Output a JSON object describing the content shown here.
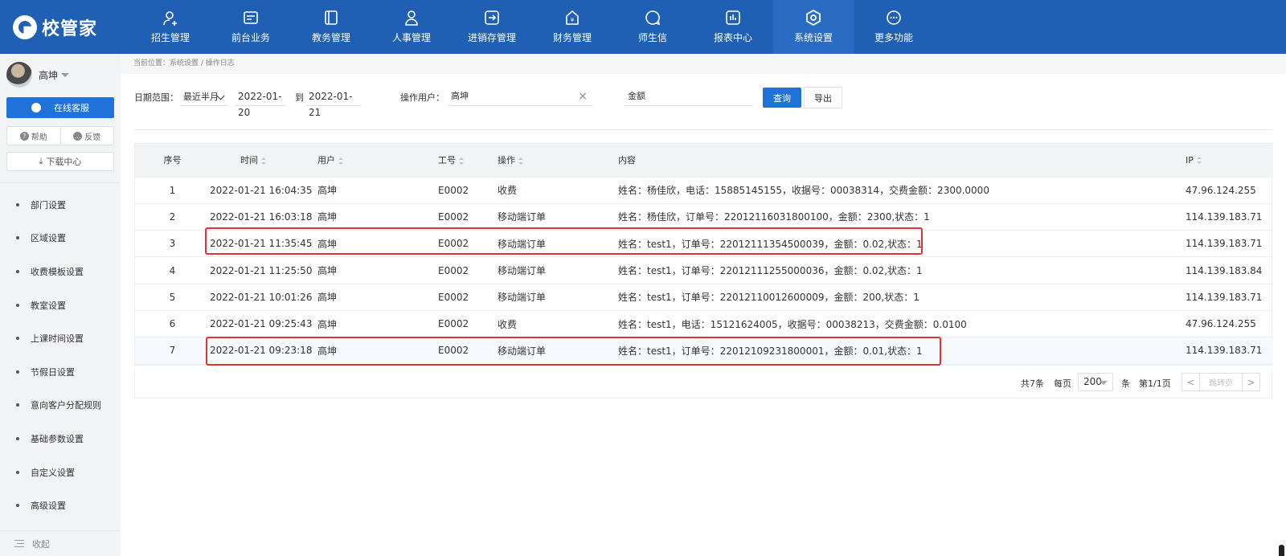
{
  "app": {
    "logo_text": "校管家"
  },
  "nav": [
    {
      "label": "招生管理",
      "icon": "person-add-icon"
    },
    {
      "label": "前台业务",
      "icon": "desk-icon"
    },
    {
      "label": "教务管理",
      "icon": "book-icon"
    },
    {
      "label": "人事管理",
      "icon": "person-icon"
    },
    {
      "label": "进销存管理",
      "icon": "arrow-box-icon"
    },
    {
      "label": "财务管理",
      "icon": "yen-house-icon"
    },
    {
      "label": "师生信",
      "icon": "chat-icon"
    },
    {
      "label": "报表中心",
      "icon": "report-icon"
    },
    {
      "label": "系统设置",
      "icon": "settings-icon",
      "active": true
    },
    {
      "label": "更多功能",
      "icon": "more-icon"
    }
  ],
  "sidebar": {
    "user_name": "高坤",
    "online_service": "在线客服",
    "help": "帮助",
    "feedback": "反馈",
    "download_center": "下载中心",
    "menu": [
      "部门设置",
      "区域设置",
      "收费模板设置",
      "教室设置",
      "上课时间设置",
      "节假日设置",
      "意向客户分配规则",
      "基础参数设置",
      "自定义设置",
      "高级设置"
    ],
    "collapse": "收起"
  },
  "breadcrumb": "当前位置：系统设置 / 操作日志",
  "filters": {
    "date_range_label": "日期范围：",
    "date_range_value": "最近半月",
    "date_from": "2022-01-20",
    "to_label": "到",
    "date_to": "2022-01-21",
    "operator_label": "操作用户：",
    "operator_value": "高坤",
    "clear": "×",
    "keyword_value": "金额",
    "query_btn": "查询",
    "export_btn": "导出"
  },
  "table": {
    "headers": {
      "idx": "序号",
      "time": "时间",
      "user": "用户",
      "job": "工号",
      "op": "操作",
      "content": "内容",
      "ip": "IP"
    },
    "rows": [
      {
        "idx": "1",
        "time": "2022-01-21 16:04:35",
        "user": "高坤",
        "job": "E0002",
        "op": "收费",
        "content": "姓名：杨佳欣，电话：15885145155，收据号：00038314，交费金额：2300.0000",
        "ip": "47.96.124.255"
      },
      {
        "idx": "2",
        "time": "2022-01-21 16:03:18",
        "user": "高坤",
        "job": "E0002",
        "op": "移动端订单",
        "content": "姓名：杨佳欣，订单号：22012116031800100，金额：2300,状态：1",
        "ip": "114.139.183.71"
      },
      {
        "idx": "3",
        "time": "2022-01-21 11:35:45",
        "user": "高坤",
        "job": "E0002",
        "op": "移动端订单",
        "content": "姓名：test1，订单号：22012111354500039，金额：0.02,状态：1",
        "ip": "114.139.183.71"
      },
      {
        "idx": "4",
        "time": "2022-01-21 11:25:50",
        "user": "高坤",
        "job": "E0002",
        "op": "移动端订单",
        "content": "姓名：test1，订单号：22012111255000036，金额：0.02,状态：1",
        "ip": "114.139.183.84"
      },
      {
        "idx": "5",
        "time": "2022-01-21 10:01:26",
        "user": "高坤",
        "job": "E0002",
        "op": "移动端订单",
        "content": "姓名：test1，订单号：22012110012600009，金额：200,状态：1",
        "ip": "114.139.183.71"
      },
      {
        "idx": "6",
        "time": "2022-01-21 09:25:43",
        "user": "高坤",
        "job": "E0002",
        "op": "收费",
        "content": "姓名：test1，电话：15121624005，收据号：00038213，交费金额：0.0100",
        "ip": "47.96.124.255"
      },
      {
        "idx": "7",
        "time": "2022-01-21 09:23:18",
        "user": "高坤",
        "job": "E0002",
        "op": "移动端订单",
        "content": "姓名：test1，订单号：22012109231800001，金额：0.01,状态：1",
        "ip": "114.139.183.71"
      }
    ]
  },
  "pager": {
    "total": "共7条",
    "per_page_label": "每页",
    "per_page_value": "200",
    "unit": "条",
    "page_info": "第1/1页",
    "prev": "<",
    "jump_placeholder": "跳转页",
    "next": ">"
  },
  "colors": {
    "nav_bg": "#1f5fb4",
    "primary": "#1f73d8",
    "highlight_box": "#e53030"
  }
}
